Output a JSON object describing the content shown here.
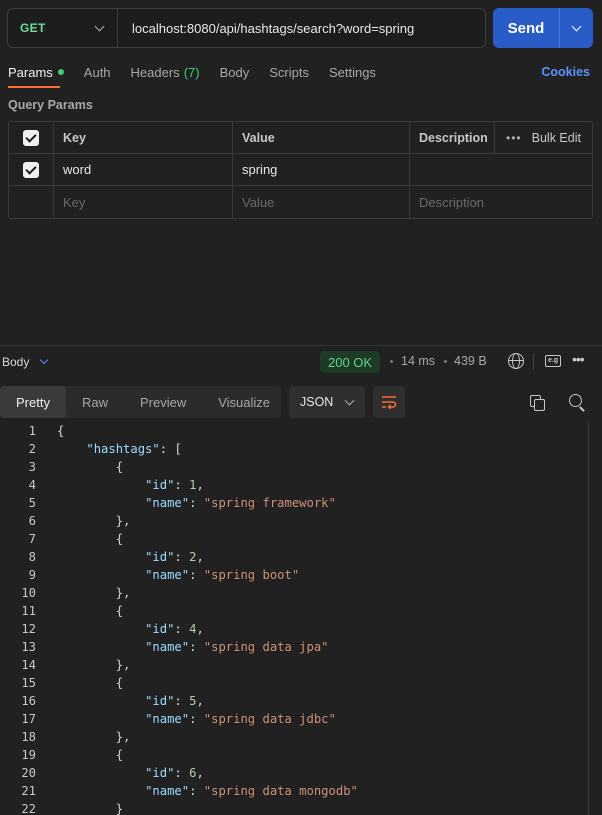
{
  "request": {
    "method": "GET",
    "url": "localhost:8080/api/hashtags/search?word=spring",
    "send_label": "Send"
  },
  "tabs": {
    "params": "Params",
    "auth": "Auth",
    "headers": "Headers",
    "headers_count": "(7)",
    "body": "Body",
    "scripts": "Scripts",
    "settings": "Settings",
    "cookies": "Cookies"
  },
  "query_params": {
    "title": "Query Params",
    "headers": {
      "key": "Key",
      "value": "Value",
      "description": "Description",
      "bulk_edit": "Bulk Edit"
    },
    "rows": [
      {
        "key": "word",
        "value": "spring",
        "description": "",
        "checked": true
      }
    ],
    "placeholders": {
      "key": "Key",
      "value": "Value",
      "description": "Description"
    }
  },
  "response": {
    "body_label": "Body",
    "status": "200 OK",
    "time": "14 ms",
    "size": "439 B",
    "view_tabs": [
      "Pretty",
      "Raw",
      "Preview",
      "Visualize"
    ],
    "active_view": "Pretty",
    "format": "JSON"
  },
  "code_lines": [
    [
      {
        "t": "p",
        "v": "{"
      }
    ],
    [
      {
        "t": "p",
        "v": "    "
      },
      {
        "t": "k",
        "v": "\"hashtags\""
      },
      {
        "t": "p",
        "v": ": ["
      }
    ],
    [
      {
        "t": "p",
        "v": "        {"
      }
    ],
    [
      {
        "t": "p",
        "v": "            "
      },
      {
        "t": "k",
        "v": "\"id\""
      },
      {
        "t": "p",
        "v": ": "
      },
      {
        "t": "n",
        "v": "1"
      },
      {
        "t": "p",
        "v": ","
      }
    ],
    [
      {
        "t": "p",
        "v": "            "
      },
      {
        "t": "k",
        "v": "\"name\""
      },
      {
        "t": "p",
        "v": ": "
      },
      {
        "t": "s",
        "v": "\"spring framework\""
      }
    ],
    [
      {
        "t": "p",
        "v": "        },"
      }
    ],
    [
      {
        "t": "p",
        "v": "        {"
      }
    ],
    [
      {
        "t": "p",
        "v": "            "
      },
      {
        "t": "k",
        "v": "\"id\""
      },
      {
        "t": "p",
        "v": ": "
      },
      {
        "t": "n",
        "v": "2"
      },
      {
        "t": "p",
        "v": ","
      }
    ],
    [
      {
        "t": "p",
        "v": "            "
      },
      {
        "t": "k",
        "v": "\"name\""
      },
      {
        "t": "p",
        "v": ": "
      },
      {
        "t": "s",
        "v": "\"spring boot\""
      }
    ],
    [
      {
        "t": "p",
        "v": "        },"
      }
    ],
    [
      {
        "t": "p",
        "v": "        {"
      }
    ],
    [
      {
        "t": "p",
        "v": "            "
      },
      {
        "t": "k",
        "v": "\"id\""
      },
      {
        "t": "p",
        "v": ": "
      },
      {
        "t": "n",
        "v": "4"
      },
      {
        "t": "p",
        "v": ","
      }
    ],
    [
      {
        "t": "p",
        "v": "            "
      },
      {
        "t": "k",
        "v": "\"name\""
      },
      {
        "t": "p",
        "v": ": "
      },
      {
        "t": "s",
        "v": "\"spring data jpa\""
      }
    ],
    [
      {
        "t": "p",
        "v": "        },"
      }
    ],
    [
      {
        "t": "p",
        "v": "        {"
      }
    ],
    [
      {
        "t": "p",
        "v": "            "
      },
      {
        "t": "k",
        "v": "\"id\""
      },
      {
        "t": "p",
        "v": ": "
      },
      {
        "t": "n",
        "v": "5"
      },
      {
        "t": "p",
        "v": ","
      }
    ],
    [
      {
        "t": "p",
        "v": "            "
      },
      {
        "t": "k",
        "v": "\"name\""
      },
      {
        "t": "p",
        "v": ": "
      },
      {
        "t": "s",
        "v": "\"spring data jdbc\""
      }
    ],
    [
      {
        "t": "p",
        "v": "        },"
      }
    ],
    [
      {
        "t": "p",
        "v": "        {"
      }
    ],
    [
      {
        "t": "p",
        "v": "            "
      },
      {
        "t": "k",
        "v": "\"id\""
      },
      {
        "t": "p",
        "v": ": "
      },
      {
        "t": "n",
        "v": "6"
      },
      {
        "t": "p",
        "v": ","
      }
    ],
    [
      {
        "t": "p",
        "v": "            "
      },
      {
        "t": "k",
        "v": "\"name\""
      },
      {
        "t": "p",
        "v": ": "
      },
      {
        "t": "s",
        "v": "\"spring data mongodb\""
      }
    ],
    [
      {
        "t": "p",
        "v": "        }"
      }
    ]
  ]
}
